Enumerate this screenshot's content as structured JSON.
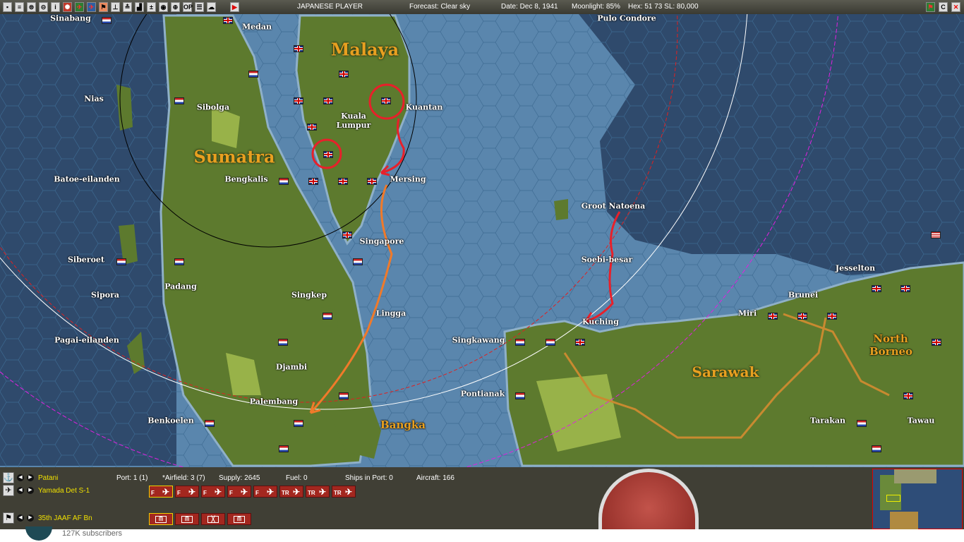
{
  "topbar": {
    "player": "JAPANESE PLAYER",
    "forecast": "Forecast: Clear sky",
    "date": "Date: Dec 8, 1941",
    "moonlight": "Moonlight: 85%",
    "hex": "Hex: 51  73  SL: 80,000",
    "op_label": "OP",
    "c_label": "C"
  },
  "map": {
    "regions": {
      "malaya": "Malaya",
      "sumatra": "Sumatra",
      "sarawak": "Sarawak",
      "north_borneo": "North Borneo",
      "bangka": "Bangka"
    },
    "places": [
      "Sinabang",
      "Medan",
      "Pulo Condore",
      "Nias",
      "Sibolga",
      "Kuala Lumpur",
      "Kuantan",
      "Batoe-eilanden",
      "Bengkalis",
      "Mersing",
      "Groot Natoena",
      "Singapore",
      "Siberoet",
      "Soebi-besar",
      "Jesselton",
      "Padang",
      "Sipora",
      "Singkep",
      "Brunei",
      "Lingga",
      "Miri",
      "Kuching",
      "Pagai-eilanden",
      "Singkawang",
      "Djambi",
      "Pontianak",
      "Palembang",
      "Benkoelen",
      "Tarakan",
      "Tawau"
    ]
  },
  "panel": {
    "base_name": "Patani",
    "port": "Port: 1 (1)",
    "airfield": "*Airfield: 3 (7)",
    "supply": "Supply: 2645",
    "fuel": "Fuel: 0",
    "ships": "Ships in Port: 0",
    "aircraft": "Aircraft: 166",
    "air_unit": "Yamada Det S-1",
    "air_squadrons": [
      "F",
      "F",
      "F",
      "F",
      "F",
      "TR",
      "TR",
      "TR"
    ],
    "land_unit": "35th JAAF AF Bn",
    "land_units": [
      "m",
      "m",
      "x",
      "m"
    ]
  },
  "youtube": {
    "subscribers": "127K subscribers"
  },
  "colors": {
    "sea": "#5a86ad",
    "deep_sea": "#2f4a6c",
    "land": "#5d7a2e",
    "panel": "#403f35",
    "annotation_red": "#e8202a",
    "annotation_orange": "#f07a2a"
  }
}
